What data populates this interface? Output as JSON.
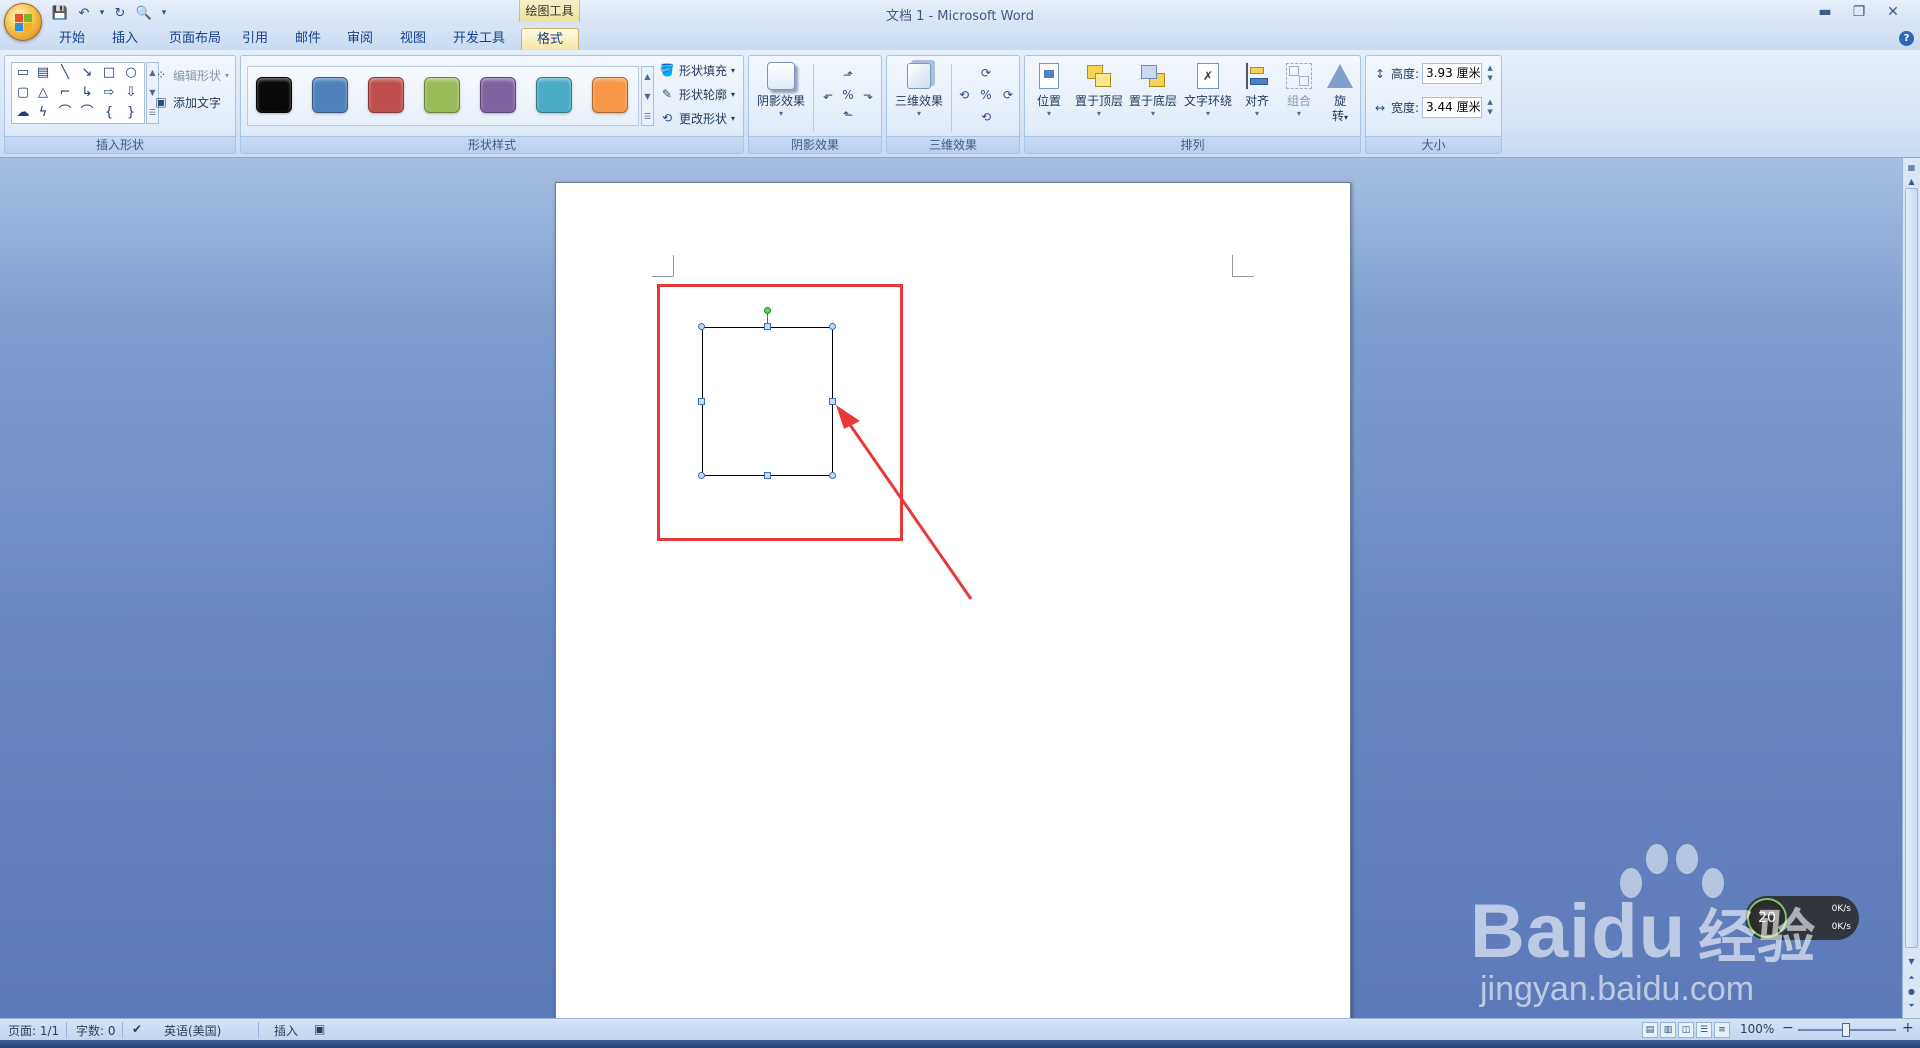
{
  "window": {
    "title": "文档 1 - Microsoft Word",
    "minimize": "▬",
    "restore": "❐",
    "close": "✕"
  },
  "qat": {
    "save": "💾",
    "undo": "↶",
    "undo_more": "▾",
    "redo": "↻",
    "print_preview": "🔍",
    "customize": "▾"
  },
  "context_tab": {
    "group_title": "绘图工具"
  },
  "tabs": [
    {
      "label": "开始"
    },
    {
      "label": "插入"
    },
    {
      "label": "页面布局"
    },
    {
      "label": "引用"
    },
    {
      "label": "邮件"
    },
    {
      "label": "审阅"
    },
    {
      "label": "视图"
    },
    {
      "label": "开发工具"
    },
    {
      "label": "格式"
    }
  ],
  "ribbon": {
    "insert_shapes": {
      "label": "插入形状",
      "edit_shape": "编辑形状",
      "edit_shape_arrow": "▾",
      "add_text": "添加文字",
      "shapes": [
        "▭",
        "▤",
        "╲",
        "↘",
        "□",
        "○",
        "▢",
        "△",
        "⌐",
        "↳",
        "⇨",
        "⇩",
        "☁",
        "ϟ",
        "⌒",
        "⌒",
        "{",
        "}"
      ]
    },
    "shape_styles": {
      "label": "形状样式",
      "fill": "形状填充",
      "outline": "形状轮廓",
      "change_shape": "更改形状",
      "dropdown": "▾",
      "swatches": [
        "#0a0a0a",
        "#4f81bd",
        "#c0504d",
        "#9bbb59",
        "#8064a2",
        "#4bacc6",
        "#f79646"
      ]
    },
    "shadow": {
      "label": "阴影效果",
      "button": "阴影效果"
    },
    "threed": {
      "label": "三维效果",
      "button": "三维效果"
    },
    "arrange": {
      "label": "排列",
      "position": "位置",
      "bring_front": "置于顶层",
      "send_back": "置于底层",
      "text_wrap": "文字环绕",
      "align": "对齐",
      "group": "组合",
      "rotate_1": "旋",
      "rotate_2": "转"
    },
    "size": {
      "label": "大小",
      "height_label": "高度:",
      "height_value": "3.93 厘米",
      "width_label": "宽度:",
      "width_value": "3.44 厘米"
    }
  },
  "status": {
    "page": "页面: 1/1",
    "words": "字数: 0",
    "language": "英语(美国)",
    "mode": "插入",
    "zoom": "100%",
    "zoom_out": "−",
    "zoom_in": "+"
  },
  "net_widget": {
    "percent": "20",
    "up": "0K/s",
    "down": "0K/s"
  },
  "watermark": {
    "brand": "Bai",
    "brand_du": "du",
    "suffix": "经验",
    "url": "jingyan.baidu.com"
  },
  "colors": {
    "highlight": "#e8393a",
    "ribbon_text": "#15428b"
  }
}
